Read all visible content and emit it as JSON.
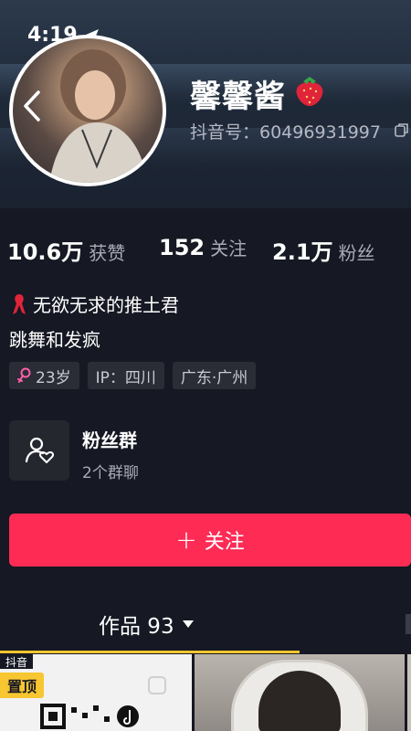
{
  "status_bar": {
    "time": "4:19"
  },
  "profile": {
    "nickname": "馨馨酱",
    "douyin_id": "抖音号：60496931997"
  },
  "stats": [
    {
      "value": "10.6万",
      "label": "获赞"
    },
    {
      "value": "152",
      "label": "关注"
    },
    {
      "value": "2.1万",
      "label": "粉丝"
    }
  ],
  "bio": {
    "line1": "无欲无求的推土君",
    "line2": "跳舞和发疯"
  },
  "tags": [
    {
      "text": "23岁",
      "icon": "female-icon",
      "color": "#ff5ea8"
    },
    {
      "text": "IP：四川"
    },
    {
      "text": "广东·广州"
    }
  ],
  "fan_group": {
    "title": "粉丝群",
    "subtitle": "2个群聊"
  },
  "follow_button": {
    "label": "关注"
  },
  "tabs": {
    "works_label": "作品 93"
  },
  "grid": {
    "pinned_badge": "置顶",
    "logo_text": "抖音"
  },
  "colors": {
    "accent": "#fe2c55",
    "background": "#161823",
    "tab_indicator": "#f7c630"
  }
}
